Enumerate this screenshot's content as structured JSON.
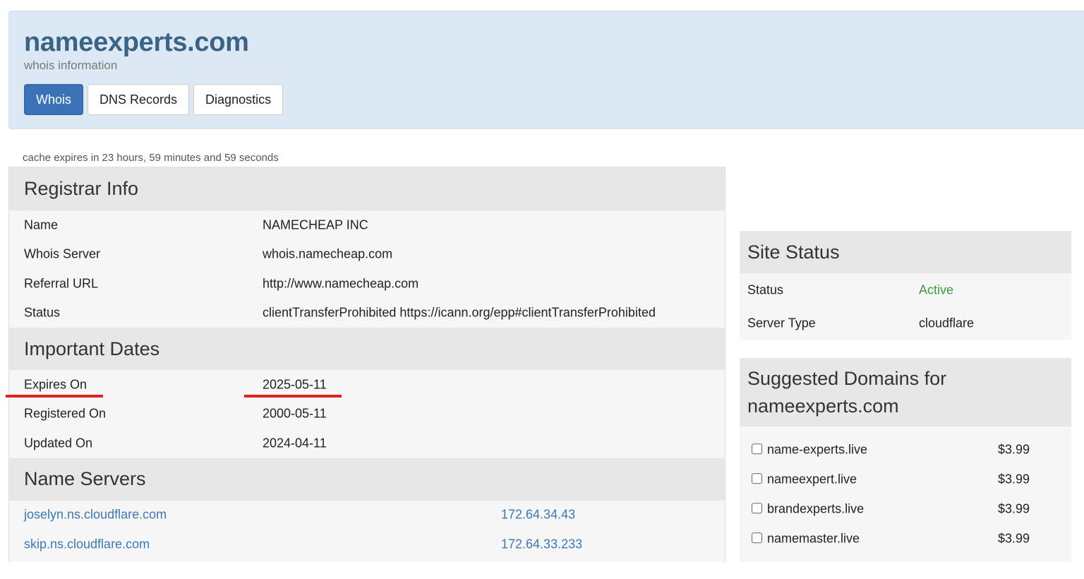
{
  "header": {
    "title": "nameexperts.com",
    "subtitle": "whois information",
    "tabs": [
      "Whois",
      "DNS Records",
      "Diagnostics"
    ]
  },
  "cache_note": "cache expires in 23 hours, 59 minutes and 59 seconds",
  "registrar": {
    "heading": "Registrar Info",
    "rows": [
      {
        "k": "Name",
        "v": "NAMECHEAP INC"
      },
      {
        "k": "Whois Server",
        "v": "whois.namecheap.com"
      },
      {
        "k": "Referral URL",
        "v": "http://www.namecheap.com"
      },
      {
        "k": "Status",
        "v": "clientTransferProhibited https://icann.org/epp#clientTransferProhibited"
      }
    ]
  },
  "dates": {
    "heading": "Important Dates",
    "rows": [
      {
        "k": "Expires On",
        "v": "2025-05-11"
      },
      {
        "k": "Registered On",
        "v": "2000-05-11"
      },
      {
        "k": "Updated On",
        "v": "2024-04-11"
      }
    ]
  },
  "nameservers": {
    "heading": "Name Servers",
    "rows": [
      {
        "host": "joselyn.ns.cloudflare.com",
        "ip": "172.64.34.43"
      },
      {
        "host": "skip.ns.cloudflare.com",
        "ip": "172.64.33.233"
      }
    ]
  },
  "site_status": {
    "heading": "Site Status",
    "rows": [
      {
        "k": "Status",
        "v": "Active"
      },
      {
        "k": "Server Type",
        "v": "cloudflare"
      }
    ]
  },
  "suggested": {
    "heading_line1": "Suggested Domains for",
    "heading_line2": "nameexperts.com",
    "items": [
      {
        "name": "name-experts.live",
        "price": "$3.99"
      },
      {
        "name": "nameexpert.live",
        "price": "$3.99"
      },
      {
        "name": "brandexperts.live",
        "price": "$3.99"
      },
      {
        "name": "namemaster.live",
        "price": "$3.99"
      }
    ]
  },
  "colors": {
    "accent": "#3b72b7",
    "header_bg": "#dce9f5",
    "link": "#3b78b8",
    "active": "#3c9a3c",
    "annotation": "#e2231a"
  }
}
